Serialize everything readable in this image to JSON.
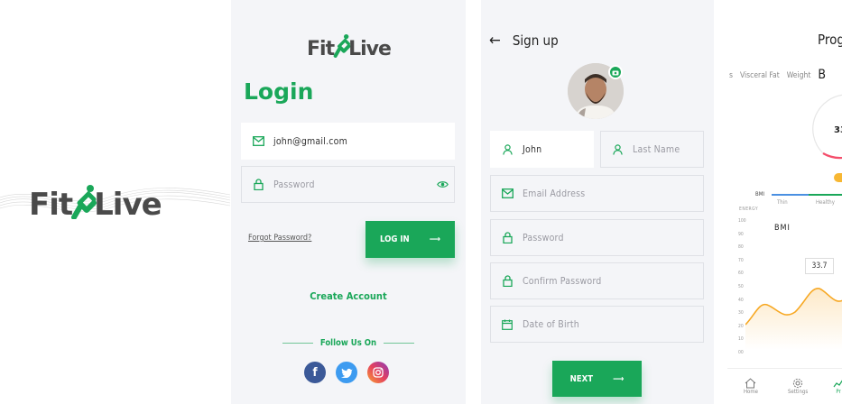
{
  "brand": {
    "name_fit": "Fit",
    "name_live": "Live",
    "accent": "#1aa759",
    "gray": "#4a4a4a"
  },
  "login": {
    "title": "Login",
    "email_value": "john@gmail.com",
    "password_placeholder": "Password",
    "forgot_label": "Forgot Password?",
    "login_button": "LOG IN",
    "create_account": "Create Account",
    "follow_label": "Follow Us On",
    "socials": [
      "facebook-icon",
      "twitter-icon",
      "instagram-icon"
    ]
  },
  "signup": {
    "title": "Sign up",
    "first_name_value": "John",
    "last_name_placeholder": "Last Name",
    "email_placeholder": "Email Address",
    "password_placeholder": "Password",
    "confirm_password_placeholder": "Confirm Password",
    "dob_placeholder": "Date of Birth",
    "next_button": "NEXT"
  },
  "progress": {
    "title": "Prog",
    "tabs": [
      "s",
      "Visceral Fat",
      "Weight",
      "B"
    ],
    "gauge_value": "33",
    "scale_label": "BMI",
    "scale_ticks": [
      "Thin",
      "Healthy"
    ],
    "energy_label": "ENERGY",
    "chart_label": "BMI",
    "y_ticks": [
      "100",
      "90",
      "80",
      "70",
      "60",
      "50",
      "40",
      "30",
      "20",
      "10",
      "00"
    ],
    "point_label": "33.7",
    "nav": [
      "Home",
      "Settings",
      "Pr"
    ]
  }
}
